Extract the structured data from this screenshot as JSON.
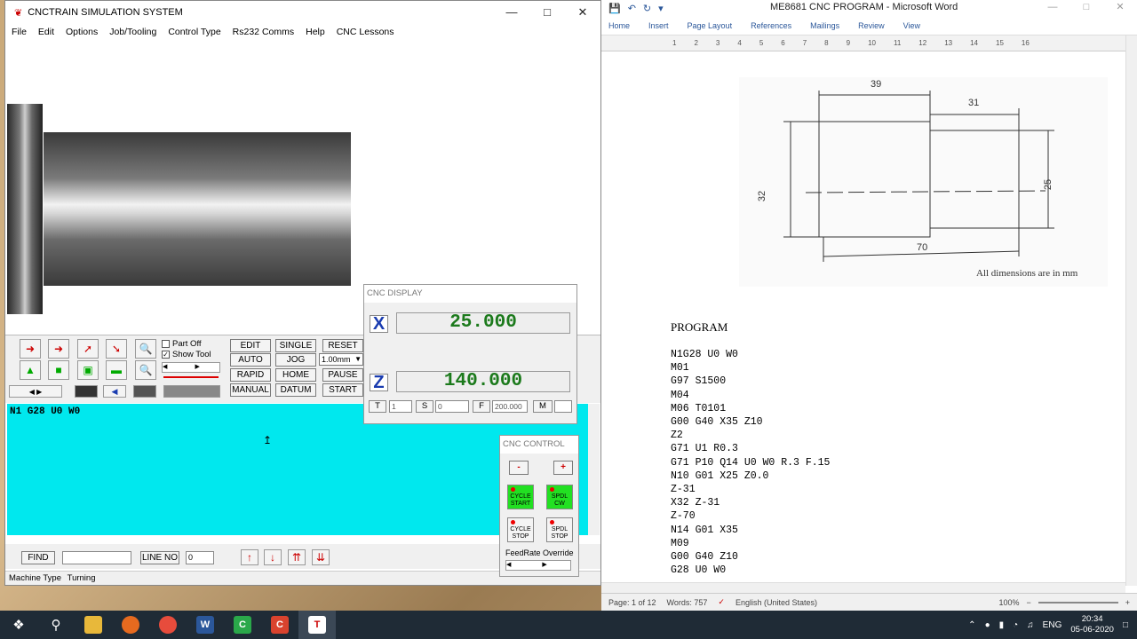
{
  "word": {
    "title": "ME8681 CNC PROGRAM - Microsoft Word",
    "ribbon_tabs": [
      "Home",
      "Insert",
      "Page Layout",
      "References",
      "Mailings",
      "Review",
      "View"
    ],
    "ruler_marks": [
      "1",
      "2",
      "3",
      "4",
      "5",
      "6",
      "7",
      "8",
      "9",
      "10",
      "11",
      "12",
      "13",
      "14",
      "15",
      "16"
    ],
    "drawing": {
      "dim_39": "39",
      "dim_31": "31",
      "dim_32": "32",
      "dim_25": "25",
      "dim_70": "70"
    },
    "dimension_note": "All dimensions are in mm",
    "program_title": "PROGRAM",
    "program_lines": [
      "N1G28 U0 W0",
      "M01",
      "G97 S1500",
      "M04",
      "M06 T0101",
      "G00 G40 X35 Z10",
      "Z2",
      "G71 U1 R0.3",
      "G71 P10 Q14 U0 W0 R.3 F.15",
      "N10 G01 X25 Z0.0",
      "Z-31",
      "X32 Z-31",
      "Z-70",
      "N14 G01 X35",
      "M09",
      "G00 G40 Z10",
      "G28 U0 W0"
    ],
    "status": {
      "page": "Page: 1 of 12",
      "words": "Words: 757",
      "language": "English (United States)",
      "zoom": "100%"
    }
  },
  "cnc": {
    "title": "CNCTRAIN SIMULATION SYSTEM",
    "menu": [
      "File",
      "Edit",
      "Options",
      "Job/Tooling",
      "Control Type",
      "Rs232 Comms",
      "Help",
      "CNC Lessons"
    ],
    "checkbox_part_off": "Part Off",
    "checkbox_show_tool": "Show Tool",
    "mode_buttons": {
      "edit": "EDIT",
      "single": "SINGLE",
      "reset": "RESET",
      "auto": "AUTO",
      "jog": "JOG",
      "rapid": "RAPID",
      "home": "HOME",
      "pause": "PAUSE",
      "manual": "MANUAL",
      "datum": "DATUM",
      "start": "START"
    },
    "jog_step": "1.00mm",
    "editor_line": "N1 G28 U0 W0",
    "find_label": "FIND",
    "line_no_label": "LINE NO",
    "line_no_value": "0",
    "status_label": "Machine Type",
    "status_value": "Turning"
  },
  "cnc_display": {
    "title": "CNC DISPLAY",
    "x_label": "X",
    "x_value": "25.000",
    "z_label": "Z",
    "z_value": "140.000",
    "t_label": "T",
    "t_value": "1",
    "s_label": "S",
    "s_value": "0",
    "f_label": "F",
    "f_value": "200.000",
    "m_label": "M",
    "m_value": ""
  },
  "cnc_control": {
    "title": "CNC CONTROL",
    "minus": "-",
    "plus": "+",
    "cycle_start": "CYCLE START",
    "spdl_cw": "SPDL CW",
    "cycle_stop": "CYCLE STOP",
    "spdl_stop": "SPDL STOP",
    "feedrate_label": "FeedRate Override"
  },
  "taskbar": {
    "language": "ENG",
    "time": "20:34",
    "date": "05-06-2020"
  }
}
